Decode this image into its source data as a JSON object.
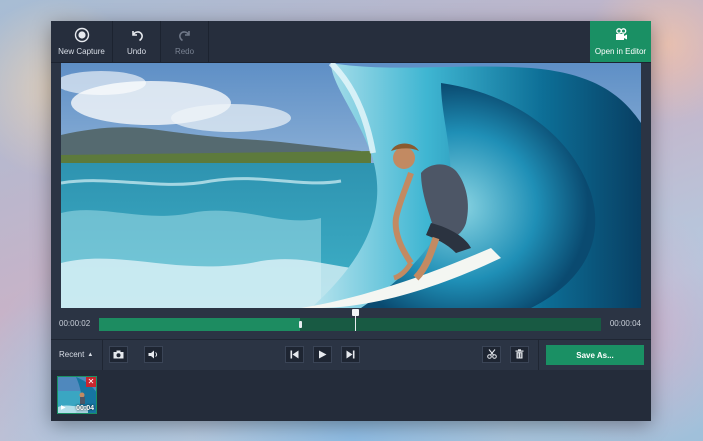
{
  "toolbar": {
    "new_capture": "New Capture",
    "undo": "Undo",
    "redo": "Redo",
    "open_in_editor": "Open in Editor"
  },
  "timeline": {
    "start_time": "00:00:02",
    "end_time": "00:00:04",
    "played_fraction": 0.4,
    "playhead_fraction": 0.51
  },
  "controls": {
    "recent_label": "Recent",
    "save_as": "Save As..."
  },
  "recent": {
    "items": [
      {
        "duration": "00:04"
      }
    ]
  },
  "colors": {
    "accent": "#1a9064",
    "window_bg": "#2b3444",
    "close_red": "#c8262e"
  },
  "icons": {
    "new_capture": "record-icon",
    "undo": "undo-icon",
    "redo": "redo-icon",
    "open_in_editor": "video-camera-icon",
    "screenshot": "camera-icon",
    "volume": "speaker-icon",
    "prev": "skip-back-icon",
    "play": "play-icon",
    "next": "skip-forward-icon",
    "cut": "scissors-icon",
    "delete": "trash-icon"
  }
}
